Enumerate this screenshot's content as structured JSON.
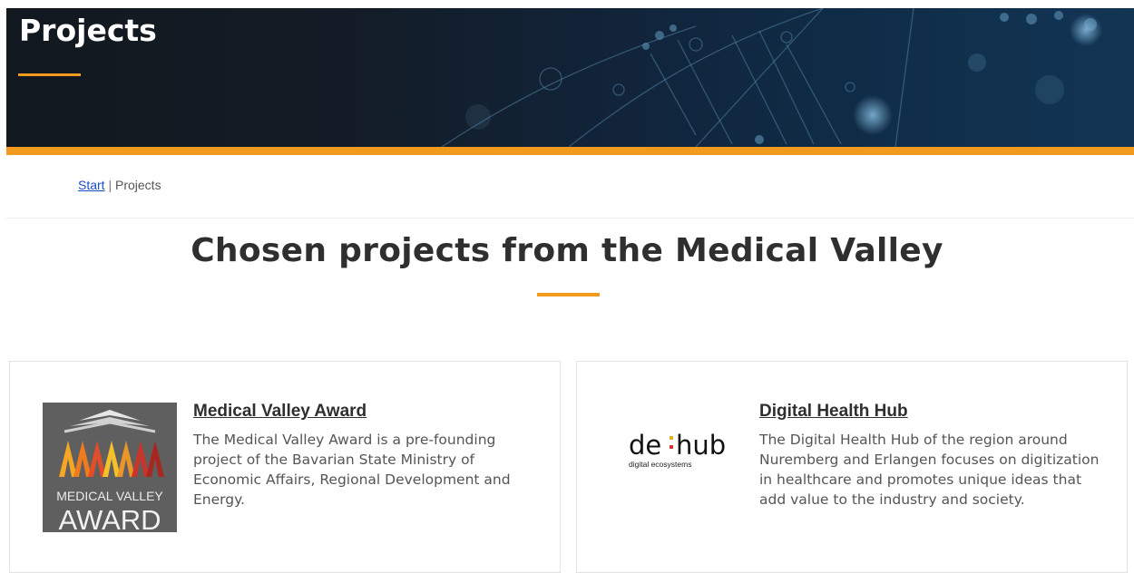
{
  "hero": {
    "title": "Projects"
  },
  "breadcrumb": {
    "home_label": "Start",
    "separator": "|",
    "current_label": "Projects"
  },
  "main": {
    "heading": "Chosen projects from the Medical Valley"
  },
  "projects": [
    {
      "title": "Medical Valley Award",
      "description": "The Medical Valley Award is a pre-founding project of the Bavarian State Ministry of Economic Affairs, Regional Development and Energy.",
      "logo": {
        "line1": "MEDICAL VALLEY",
        "line2": "AWARD"
      }
    },
    {
      "title": "Digital Health Hub",
      "description": "The Digital Health Hub of the region around Nuremberg and Erlangen focuses on digitization in healthcare and promotes unique ideas that add value to the industry and society.",
      "logo": {
        "word_left": "de",
        "word_right": "hub",
        "tagline": "digital ecosystems"
      }
    }
  ],
  "colors": {
    "accent": "#f29a1d",
    "link": "#1a4dc9",
    "hero_bg": "#131c26"
  }
}
